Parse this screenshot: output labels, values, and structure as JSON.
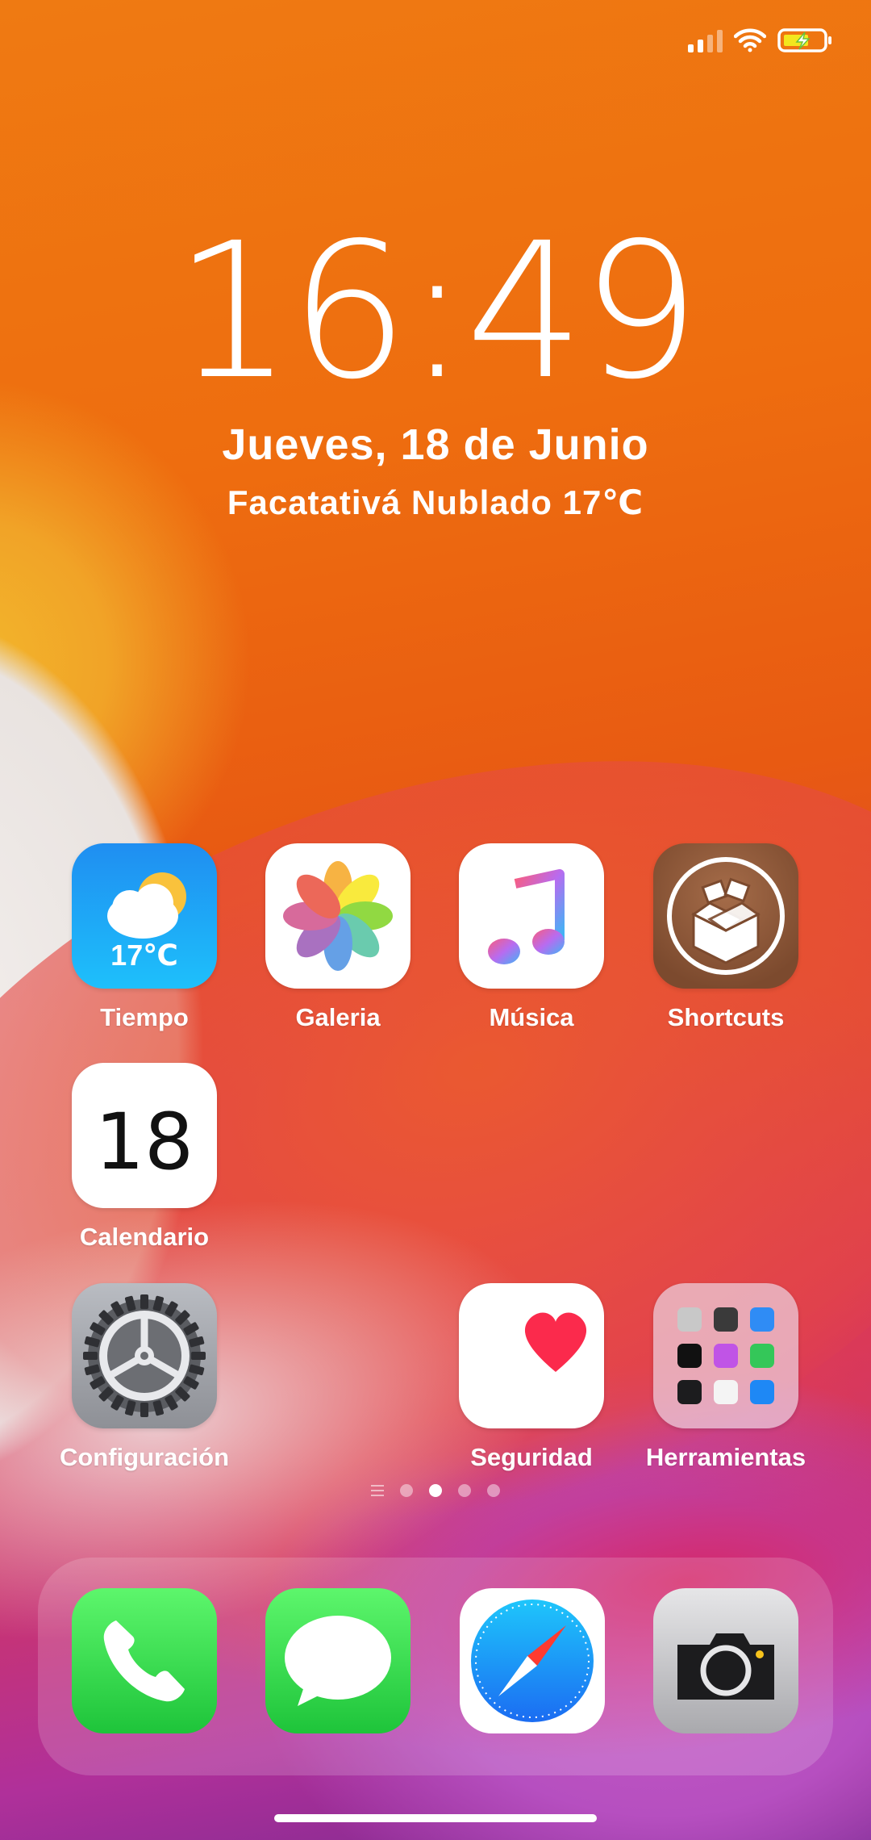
{
  "status_bar": {
    "signal_icon": "cellular-signal-icon",
    "wifi_icon": "wifi-icon",
    "battery_icon": "battery-charging-icon"
  },
  "lock": {
    "time": "16:49",
    "date": "Jueves, 18 de Junio",
    "weather": "Facatativá  Nublado  17℃"
  },
  "apps": [
    {
      "label": "Tiempo",
      "icon": "weather-icon",
      "badge_text": "17℃"
    },
    {
      "label": "Galeria",
      "icon": "photos-icon"
    },
    {
      "label": "Música",
      "icon": "music-icon"
    },
    {
      "label": "Shortcuts",
      "icon": "cydia-box-icon"
    },
    {
      "label": "Calendario",
      "icon": "calendar-icon",
      "day": "18"
    },
    {
      "label": "Configuración",
      "icon": "settings-gear-icon"
    },
    {
      "label": "Seguridad",
      "icon": "health-heart-icon"
    },
    {
      "label": "Herramientas",
      "icon": "folder-icon"
    }
  ],
  "page_indicator": {
    "pages": 4,
    "active_index": 1
  },
  "dock": [
    {
      "name": "Teléfono",
      "icon": "phone-icon"
    },
    {
      "name": "Mensajes",
      "icon": "messages-icon"
    },
    {
      "name": "Safari",
      "icon": "safari-compass-icon"
    },
    {
      "name": "Cámara",
      "icon": "camera-icon"
    }
  ],
  "colors": {
    "wallpaper_top": "#ef7a12",
    "wallpaper_bottom": "#7a2a90",
    "weather_icon_bg": "#1f8ef1",
    "phone_green": "#1ec43a"
  }
}
